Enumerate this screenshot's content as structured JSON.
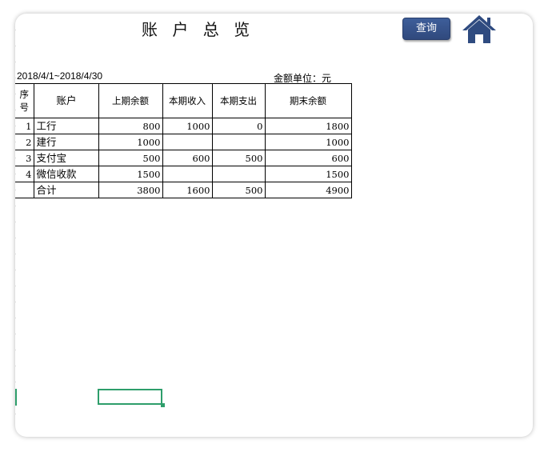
{
  "header": {
    "title": "账 户 总 览",
    "query_label": "查询",
    "home_icon": "home-icon"
  },
  "period": {
    "date_range": "2018/4/1~2018/4/30",
    "unit_label": "金额单位：元"
  },
  "table": {
    "columns": {
      "no": "序号",
      "account": "账户",
      "opening": "上期余额",
      "income": "本期收入",
      "expense": "本期支出",
      "closing": "期末余额"
    },
    "rows": [
      {
        "no": "1",
        "account": "工行",
        "opening": "800",
        "income": "1000",
        "expense": "0",
        "closing": "1800"
      },
      {
        "no": "2",
        "account": "建行",
        "opening": "1000",
        "income": "",
        "expense": "",
        "closing": "1000"
      },
      {
        "no": "3",
        "account": "支付宝",
        "opening": "500",
        "income": "600",
        "expense": "500",
        "closing": "600"
      },
      {
        "no": "4",
        "account": "微信收款",
        "opening": "1500",
        "income": "",
        "expense": "",
        "closing": "1500"
      }
    ],
    "total": {
      "no": "",
      "account": "合计",
      "opening": "3800",
      "income": "1600",
      "expense": "500",
      "closing": "4900"
    }
  },
  "colors": {
    "button": "#3b5998",
    "home_icon": "#2f4b80",
    "selection": "#2e9e6b"
  }
}
